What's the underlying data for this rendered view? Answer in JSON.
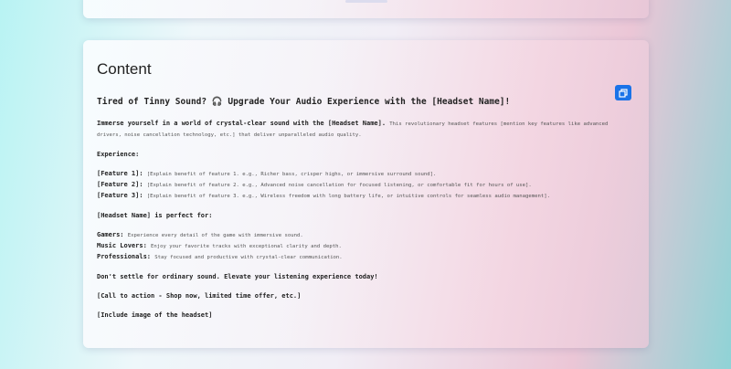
{
  "card_title": "Content",
  "headline": "Tired of Tinny Sound? 🎧 Upgrade Your Audio Experience with the [Headset Name]!",
  "intro_bold": "Immerse yourself in a world of crystal-clear sound with the [Headset Name].",
  "intro_rest": "This revolutionary headset features [mention key features like advanced drivers, noise cancellation technology, etc.] that deliver unparalleled audio quality.",
  "experience_label": "Experience:",
  "features": [
    {
      "label": "[Feature 1]:",
      "text": "[Explain benefit of feature 1. e.g., Richer bass, crisper highs, or immersive surround sound]."
    },
    {
      "label": "[Feature 2]:",
      "text": "[Explain benefit of feature 2. e.g., Advanced noise cancellation for focused listening, or comfortable fit for hours of use]."
    },
    {
      "label": "[Feature 3]:",
      "text": "[Explain benefit of feature 3. e.g., Wireless freedom with long battery life, or intuitive controls for seamless audio management]."
    }
  ],
  "perfect_for": "[Headset Name] is perfect for:",
  "audiences": [
    {
      "label": "Gamers:",
      "text": "Experience every detail of the game with immersive sound."
    },
    {
      "label": "Music Lovers:",
      "text": "Enjoy your favorite tracks with exceptional clarity and depth."
    },
    {
      "label": "Professionals:",
      "text": "Stay focused and productive with crystal-clear communication."
    }
  ],
  "closing": "Don't settle for ordinary sound. Elevate your listening experience today!",
  "cta": "[Call to action -  Shop now, limited time offer, etc.]",
  "image_note": "[Include image of the headset]",
  "colors": {
    "accent": "#1a73e8"
  },
  "icons": {
    "copy": "copy-icon"
  }
}
